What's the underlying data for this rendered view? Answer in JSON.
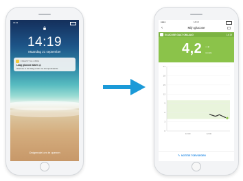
{
  "lock_screen": {
    "time": "14:19",
    "date": "Maandag 21 september",
    "notification": {
      "app": "FREESTYLE LIBRE",
      "title": "Laag glucose alarm ⚠",
      "body": "Glucose in het laag onder uw drempelwaarde"
    },
    "unlock_hint": "Ontgrendel om te openen"
  },
  "app": {
    "status_time": "14:19",
    "nav_title": "Mijn glucose",
    "card_label": "GLUCOSE GAAT OMLAAG",
    "card_time": "14:19",
    "glucose_value": "4,2",
    "trend_arrow": "→",
    "glucose_unit": "mmol/L",
    "footer_link": "NOTITIE TOEVOEGEN",
    "colors": {
      "brand_green": "#8bc34a",
      "link_blue": "#1e88e5",
      "arrow_blue": "#1b9ad8"
    }
  },
  "chart_data": {
    "type": "line",
    "y_ticks": [
      "21",
      "18",
      "15",
      "12",
      "9",
      "6",
      "3",
      "0"
    ],
    "x_ticks": [
      "10:00",
      "12:00"
    ],
    "target_range": [
      3.9,
      10.0
    ],
    "ylim": [
      0,
      21
    ],
    "series": [
      {
        "values": [
          5.5,
          5.2,
          5.0,
          4.8,
          5.0,
          5.3,
          5.0,
          4.7,
          4.4,
          4.2
        ]
      }
    ]
  }
}
